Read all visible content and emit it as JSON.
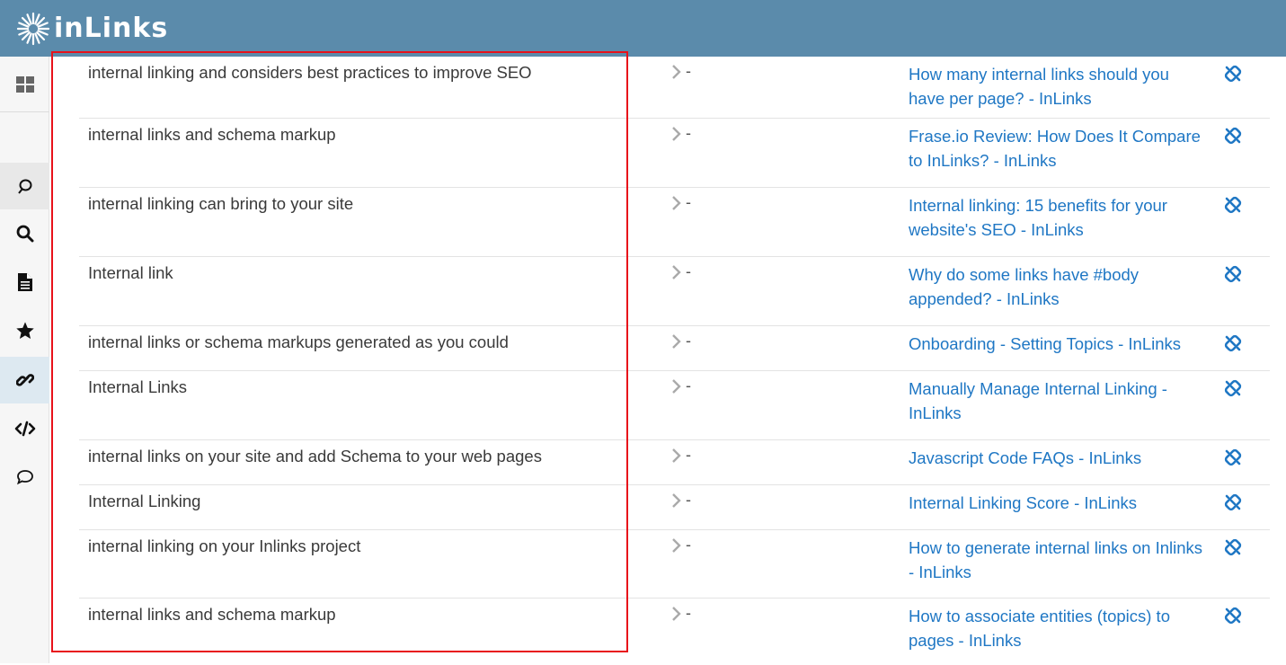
{
  "app": {
    "logo_text": "inLinks"
  },
  "sidebar": {
    "items": [
      {
        "icon": "dashboard-grid-icon"
      },
      {
        "icon": "topics-icon"
      },
      {
        "icon": "search-icon"
      },
      {
        "icon": "document-icon"
      },
      {
        "icon": "star-icon"
      },
      {
        "icon": "link-icon"
      },
      {
        "icon": "code-icon"
      },
      {
        "icon": "chat-icon"
      }
    ]
  },
  "colors": {
    "header": "#5b8bab",
    "link": "#1f77c4",
    "highlight": "#e8121a"
  },
  "rows": [
    {
      "keyword": "internal linking and considers best practices to improve SEO",
      "separator": "-",
      "link": "How many internal links should you have per page? - InLinks"
    },
    {
      "keyword": "internal links and schema markup",
      "separator": "-",
      "link": "Frase.io Review: How Does It Compare to InLinks? - InLinks"
    },
    {
      "keyword": "internal linking can bring to your site",
      "separator": "-",
      "link": "Internal linking: 15 benefits for your website's SEO - InLinks"
    },
    {
      "keyword": "Internal link",
      "separator": "-",
      "link": "Why do some links have #body appended? - InLinks"
    },
    {
      "keyword": "internal links or schema markups generated as you could",
      "separator": "-",
      "link": "Onboarding - Setting Topics - InLinks"
    },
    {
      "keyword": "Internal Links",
      "separator": "-",
      "link": "Manually Manage Internal Linking - InLinks"
    },
    {
      "keyword": "internal links on your site and add Schema to your web pages",
      "separator": "-",
      "link": "Javascript Code FAQs - InLinks"
    },
    {
      "keyword": "Internal Linking",
      "separator": "-",
      "link": "Internal Linking Score - InLinks"
    },
    {
      "keyword": "internal linking on your Inlinks project",
      "separator": "-",
      "link": "How to generate internal links on Inlinks - InLinks"
    },
    {
      "keyword": "internal links and schema markup",
      "separator": "-",
      "link": "How to associate entities (topics) to pages - InLinks"
    }
  ]
}
